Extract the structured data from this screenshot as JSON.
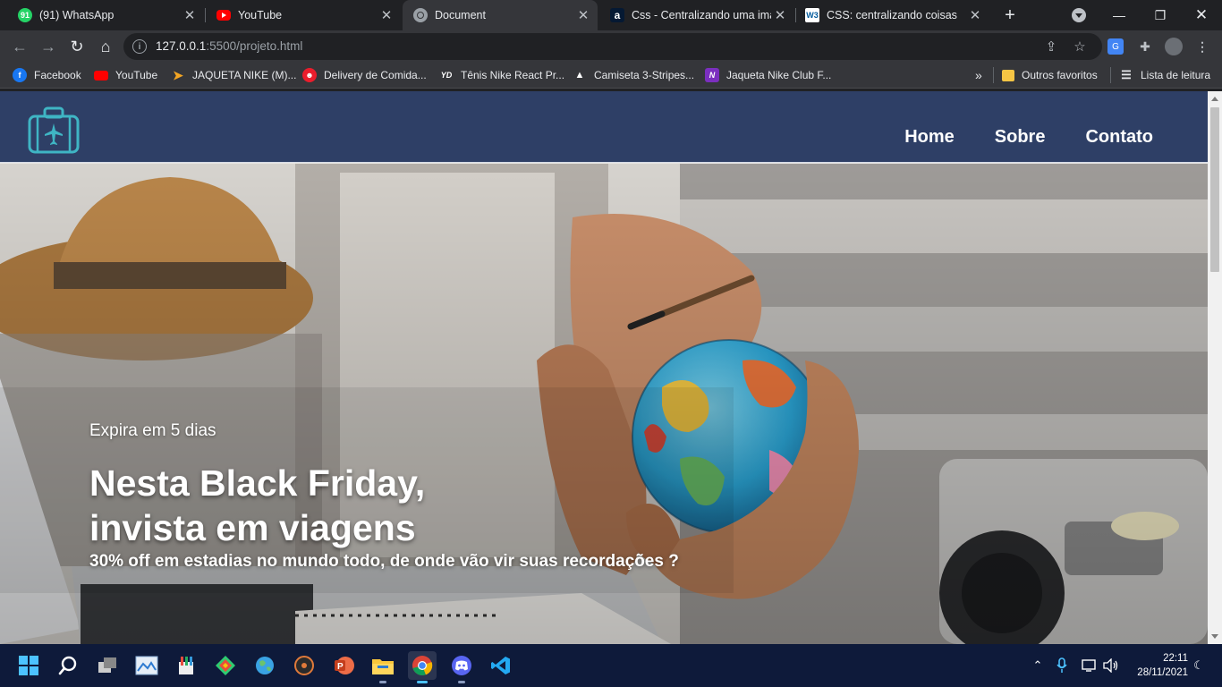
{
  "browser": {
    "tabs": [
      {
        "title": "(91) WhatsApp",
        "icon": "whatsapp-icon",
        "badge": "91",
        "active": false
      },
      {
        "title": "YouTube",
        "icon": "youtube-icon",
        "active": false
      },
      {
        "title": "Document",
        "icon": "globe-icon",
        "active": true
      },
      {
        "title": "Css - Centralizando uma imag",
        "icon": "alura-icon",
        "active": false
      },
      {
        "title": "CSS: centralizando coisas",
        "icon": "w3c-icon",
        "active": false
      }
    ],
    "address": {
      "host": "127.0.0.1",
      "path": ":5500/projeto.html"
    },
    "bookmarks": [
      {
        "label": "Facebook",
        "icon": "facebook-icon"
      },
      {
        "label": "YouTube",
        "icon": "youtube-icon"
      },
      {
        "label": "JAQUETA NIKE (M)...",
        "icon": "arrow-icon"
      },
      {
        "label": "Delivery de Comida...",
        "icon": "ifood-icon"
      },
      {
        "label": "Tênis Nike React Pr...",
        "icon": "ytd-icon"
      },
      {
        "label": "Camiseta 3-Stripes...",
        "icon": "adidas-icon"
      },
      {
        "label": "Jaqueta Nike Club F...",
        "icon": "n-icon"
      }
    ],
    "bookmarks_more": "»",
    "other_favorites": "Outros favoritos",
    "reading_list": "Lista de leitura",
    "tab_badge": "91"
  },
  "site": {
    "nav": [
      "Home",
      "Sobre",
      "Contato"
    ],
    "hero": {
      "kicker": "Expira em 5 dias",
      "headline_line1": "Nesta Black Friday,",
      "headline_line2": "invista em viagens",
      "subline": "30% off em estadias no mundo todo, de onde vão vir suas recordações ?"
    },
    "colors": {
      "header_bg": "#2e3f66",
      "logo_teal": "#3fb5c4"
    }
  },
  "taskbar": {
    "time": "22:11",
    "date": "28/11/2021",
    "apps": [
      "start-icon",
      "search-icon",
      "task-view-icon",
      "photos-icon",
      "paint-icon",
      "git-icon",
      "globe-app-icon",
      "media-player-icon",
      "powerpoint-icon",
      "file-explorer-icon",
      "chrome-icon",
      "discord-icon",
      "vscode-icon"
    ]
  }
}
